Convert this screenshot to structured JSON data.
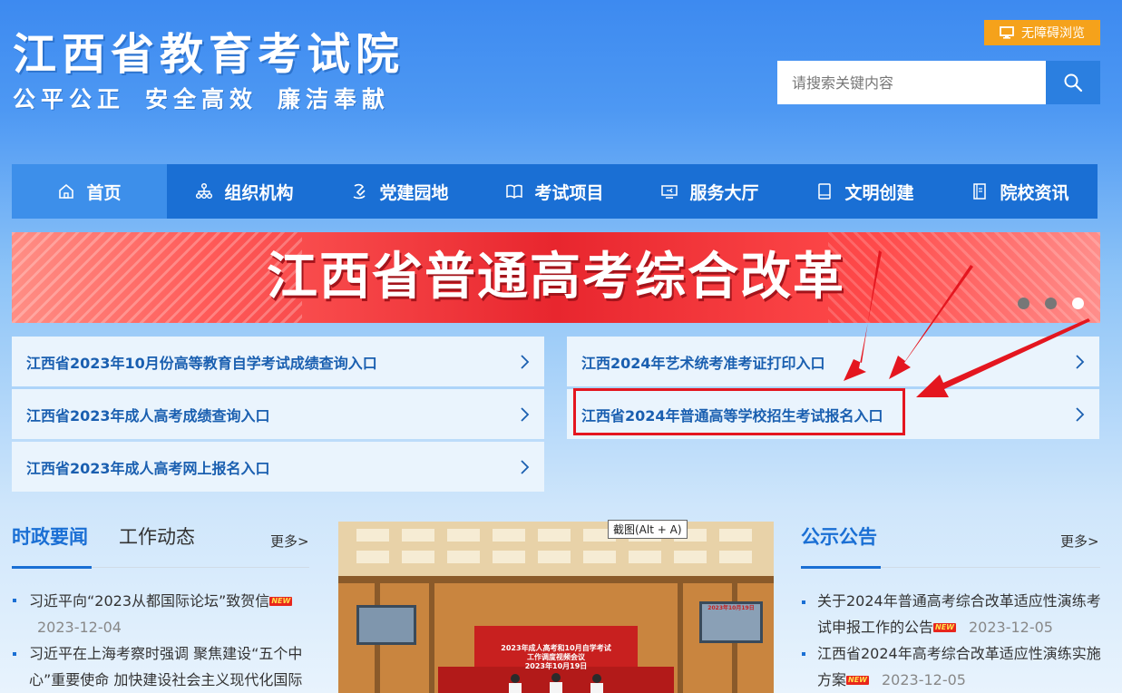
{
  "header": {
    "title": "江西省教育考试院",
    "slogan": [
      "公平公正",
      "安全高效",
      "廉洁奉献"
    ],
    "accessibility_label": "无障碍浏览",
    "search_placeholder": "请搜索关键内容"
  },
  "nav": {
    "items": [
      {
        "label": "首页",
        "icon": "home-icon",
        "active": true
      },
      {
        "label": "组织机构",
        "icon": "org-chart-icon"
      },
      {
        "label": "党建园地",
        "icon": "party-icon"
      },
      {
        "label": "考试项目",
        "icon": "book-open-icon"
      },
      {
        "label": "服务大厅",
        "icon": "service-icon"
      },
      {
        "label": "文明创建",
        "icon": "book-icon"
      },
      {
        "label": "院校资讯",
        "icon": "document-icon"
      }
    ]
  },
  "banner": {
    "text": "江西省普通高考综合改革",
    "slide_count": 3,
    "active_slide": 3
  },
  "quick_links": {
    "left": [
      "江西省2023年10月份高等教育自学考试成绩查询入口",
      "江西省2023年成人高考成绩查询入口",
      "江西省2023年成人高考网上报名入口"
    ],
    "right": [
      "江西2024年艺术统考准考证打印入口",
      "江西省2024年普通高等学校招生考试报名入口"
    ]
  },
  "news": {
    "tab_active": "时政要闻",
    "tab_inactive": "工作动态",
    "more": "更多>",
    "items": [
      {
        "title": "习近平向“2023从都国际论坛”致贺信",
        "date": "2023-12-04",
        "new_badge": "NEW"
      },
      {
        "title_line1": "习近平在上海考察时强调 聚焦建设“五个中",
        "title_line2": "心”重要使命 加快建设社会主义现代化国际"
      }
    ]
  },
  "photo": {
    "tooltip": "截图(Alt + A)",
    "banner_text_line1": "2023年成人高考和10月自学考试",
    "banner_text_line2": "工作调度视频会议",
    "banner_date": "2023年10月19日",
    "screen_date": "2023年10月19日"
  },
  "notices": {
    "title": "公示公告",
    "more": "更多>",
    "items": [
      {
        "line1": "关于2024年普通高考综合改革适应性演练考",
        "line2": "试申报工作的公告",
        "date": "2023-12-05",
        "new_badge": "NEW"
      },
      {
        "line1": "江西省2024年高考综合改革适应性演练实施",
        "line2": "方案",
        "date": "2023-12-05",
        "new_badge": "NEW"
      }
    ]
  },
  "colors": {
    "nav_bg": "#1a6fd4",
    "nav_active": "#3d8fea",
    "accent_orange": "#f5a21b",
    "highlight_red": "#e4161f",
    "link_blue": "#1a5fb0"
  }
}
